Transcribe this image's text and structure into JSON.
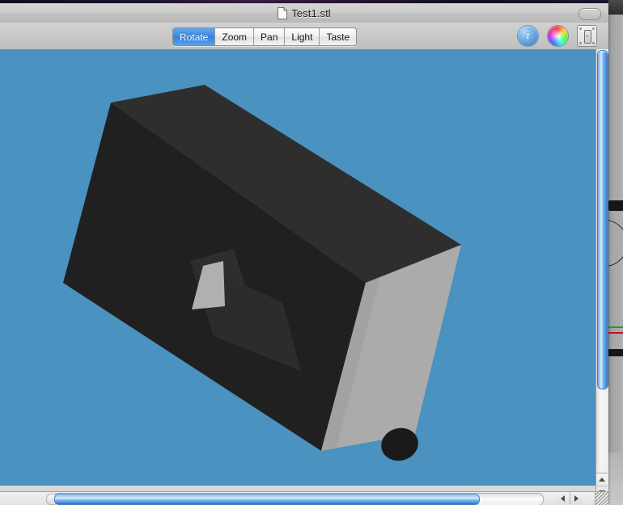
{
  "window": {
    "title": "Test1.stl",
    "doc_icon": "document-icon",
    "toolbar_toggle_icon": "toolbar-toggle-pill-icon"
  },
  "toolbar": {
    "mode_segments": [
      {
        "label": "Rotate",
        "selected": true
      },
      {
        "label": "Zoom",
        "selected": false
      },
      {
        "label": "Pan",
        "selected": false
      },
      {
        "label": "Light",
        "selected": false
      },
      {
        "label": "Taste",
        "selected": false
      }
    ],
    "icons": [
      {
        "name": "info-icon",
        "glyph": "i"
      },
      {
        "name": "color-wheel-icon",
        "glyph": ""
      },
      {
        "name": "inspector-icon",
        "glyph": ""
      }
    ]
  },
  "canvas": {
    "background_color": "#4a92bf",
    "model_name": "stl-model-box",
    "colors": {
      "face_front": "#212121",
      "face_top": "#2c2c2c",
      "face_right": "#aeaeae",
      "face_right_shadow": "#9f9f9f",
      "slot_wall": "#b0b0b0",
      "slot_floor": "#303030",
      "hole": "#1b1b1b",
      "edge": "#2a2a2a"
    }
  },
  "scrollbars": {
    "vertical": {
      "thumb_position_percent": 0,
      "thumb_size_percent": 81
    },
    "horizontal": {
      "thumb_position_percent": 2,
      "thumb_size_percent": 86
    },
    "arrows": {
      "up": "scroll-up-arrow-icon",
      "down": "scroll-down-arrow-icon",
      "left": "scroll-left-arrow-icon",
      "right": "scroll-right-arrow-icon"
    },
    "resize_grip": "window-resize-grip-icon"
  },
  "background_window": {
    "name": "background-application-window"
  }
}
